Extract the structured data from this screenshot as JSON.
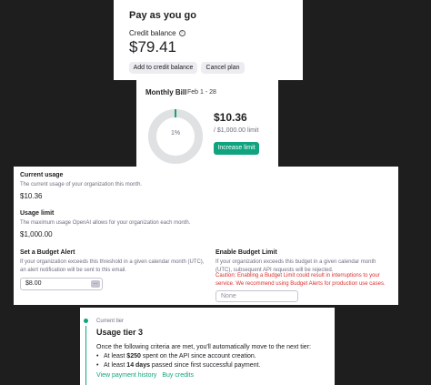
{
  "payg": {
    "title": "Pay as you go",
    "credit_label": "Credit balance",
    "info_glyph": "i",
    "balance": "$79.41",
    "add_button": "Add to credit balance",
    "cancel_button": "Cancel plan"
  },
  "bill": {
    "label": "Monthly Bill",
    "date_range": "Feb 1 - 28",
    "donut_percent": "1%",
    "usage_fraction": 0.01,
    "amount": "$10.36",
    "limit_text": "/ $1,000.00 limit",
    "increase_button": "Increase limit"
  },
  "usage": {
    "current_title": "Current usage",
    "current_desc": "The current usage of your organization this month.",
    "current_value": "$10.36",
    "limit_title": "Usage limit",
    "limit_desc": "The maximum usage OpenAI allows for your organization each month.",
    "limit_value": "$1,000.00",
    "alert_title": "Set a Budget Alert",
    "alert_desc": "If your organization exceeds this threshold in a given calendar month (UTC), an alert notification will be sent to this email.",
    "alert_value": "$8.00",
    "stepper_glyph": "⋯",
    "enable_title": "Enable Budget Limit",
    "enable_desc": "If your organization exceeds this budget in a given calendar month (UTC), subsequent API requests will be rejected.",
    "caution": "Caution: Enabling a Budget Limit could result in interruptions to your service. We recommend using Budget Alerts for production use cases.",
    "limit_placeholder": "None"
  },
  "tier": {
    "current_label": "Current tier",
    "name": "Usage tier 3",
    "intro": "Once the following criteria are met, you'll automatically move to the next tier:",
    "criteria1_pre": "At least ",
    "criteria1_bold": "$250",
    "criteria1_post": " spent on the API since account creation.",
    "criteria2_pre": "At least ",
    "criteria2_bold": "14 days",
    "criteria2_post": " passed since first successful payment.",
    "link_history": "View payment history",
    "link_buy": "Buy credits"
  },
  "colors": {
    "accent": "#10a37f",
    "danger": "#d9302c",
    "background": "#1e1e1e"
  },
  "icons": [
    "info-icon",
    "stepper-icon"
  ]
}
